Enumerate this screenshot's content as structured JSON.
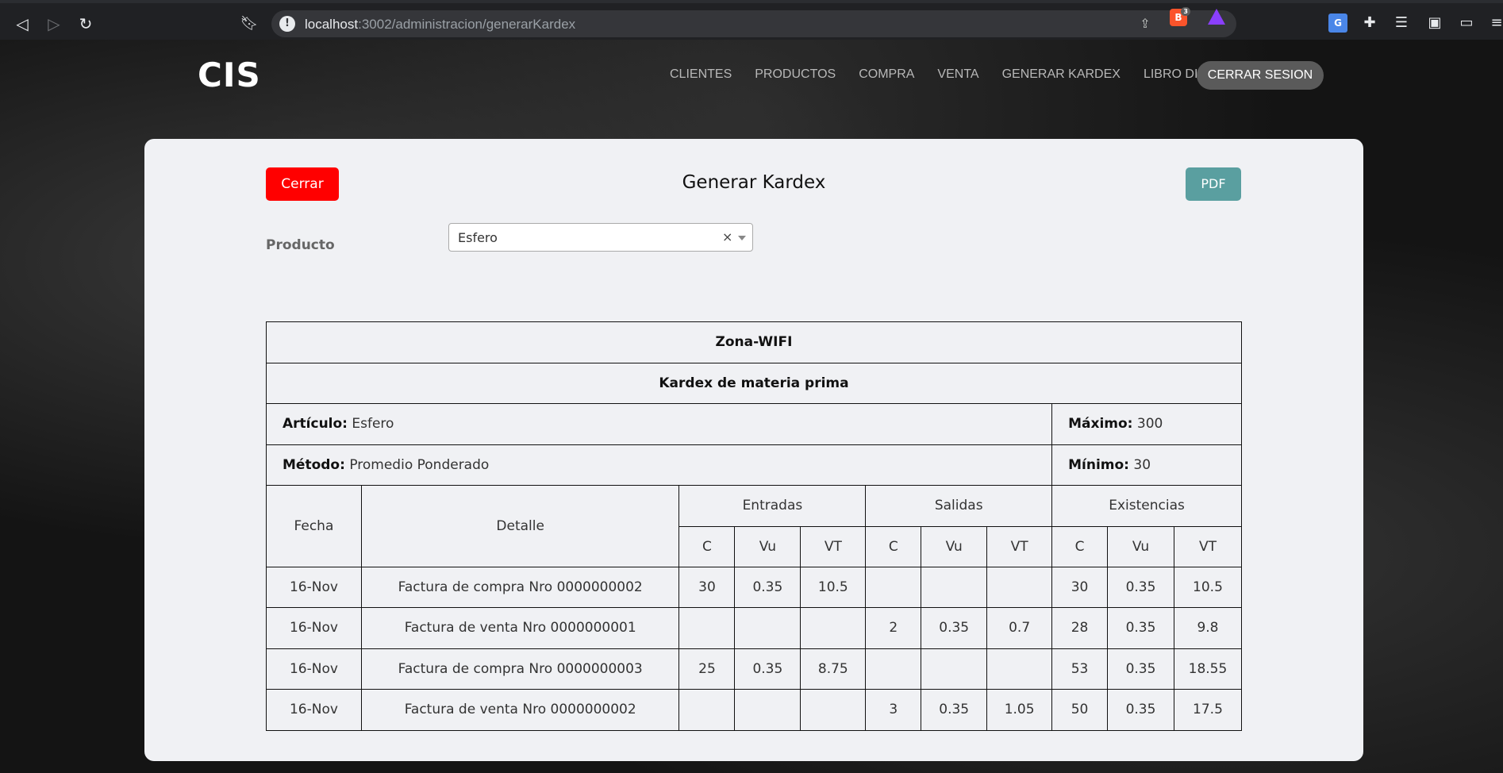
{
  "browser": {
    "url_host": "localhost",
    "url_path": ":3002/administracion/generarKardex",
    "brave_badge": "3"
  },
  "nav": {
    "brand": "CIS",
    "links": [
      "CLIENTES",
      "PRODUCTOS",
      "COMPRA",
      "VENTA",
      "GENERAR KARDEX",
      "LIBRO DIARIO"
    ],
    "logout": "CERRAR SESION"
  },
  "card": {
    "close_label": "Cerrar",
    "title": "Generar Kardex",
    "pdf_label": "PDF",
    "product_label": "Producto",
    "product_value": "Esfero",
    "clear_symbol": "×"
  },
  "kardex": {
    "company": "Zona-WIFI",
    "subtitle": "Kardex de materia prima",
    "article_label": "Artículo:",
    "article_value": "Esfero",
    "max_label": "Máximo:",
    "max_value": "300",
    "method_label": "Método:",
    "method_value": "Promedio Ponderado",
    "min_label": "Mínimo:",
    "min_value": "30",
    "headers": {
      "fecha": "Fecha",
      "detalle": "Detalle",
      "entradas": "Entradas",
      "salidas": "Salidas",
      "existencias": "Existencias",
      "c": "C",
      "vu": "Vu",
      "vt": "VT"
    },
    "rows": [
      {
        "fecha": "16-Nov",
        "detalle": "Factura de compra Nro 0000000002",
        "e_c": "30",
        "e_vu": "0.35",
        "e_vt": "10.5",
        "s_c": "",
        "s_vu": "",
        "s_vt": "",
        "x_c": "30",
        "x_vu": "0.35",
        "x_vt": "10.5"
      },
      {
        "fecha": "16-Nov",
        "detalle": "Factura de venta Nro 0000000001",
        "e_c": "",
        "e_vu": "",
        "e_vt": "",
        "s_c": "2",
        "s_vu": "0.35",
        "s_vt": "0.7",
        "x_c": "28",
        "x_vu": "0.35",
        "x_vt": "9.8"
      },
      {
        "fecha": "16-Nov",
        "detalle": "Factura de compra Nro 0000000003",
        "e_c": "25",
        "e_vu": "0.35",
        "e_vt": "8.75",
        "s_c": "",
        "s_vu": "",
        "s_vt": "",
        "x_c": "53",
        "x_vu": "0.35",
        "x_vt": "18.55"
      },
      {
        "fecha": "16-Nov",
        "detalle": "Factura de venta Nro 0000000002",
        "e_c": "",
        "e_vu": "",
        "e_vt": "",
        "s_c": "3",
        "s_vu": "0.35",
        "s_vt": "1.05",
        "x_c": "50",
        "x_vu": "0.35",
        "x_vt": "17.5"
      }
    ]
  }
}
